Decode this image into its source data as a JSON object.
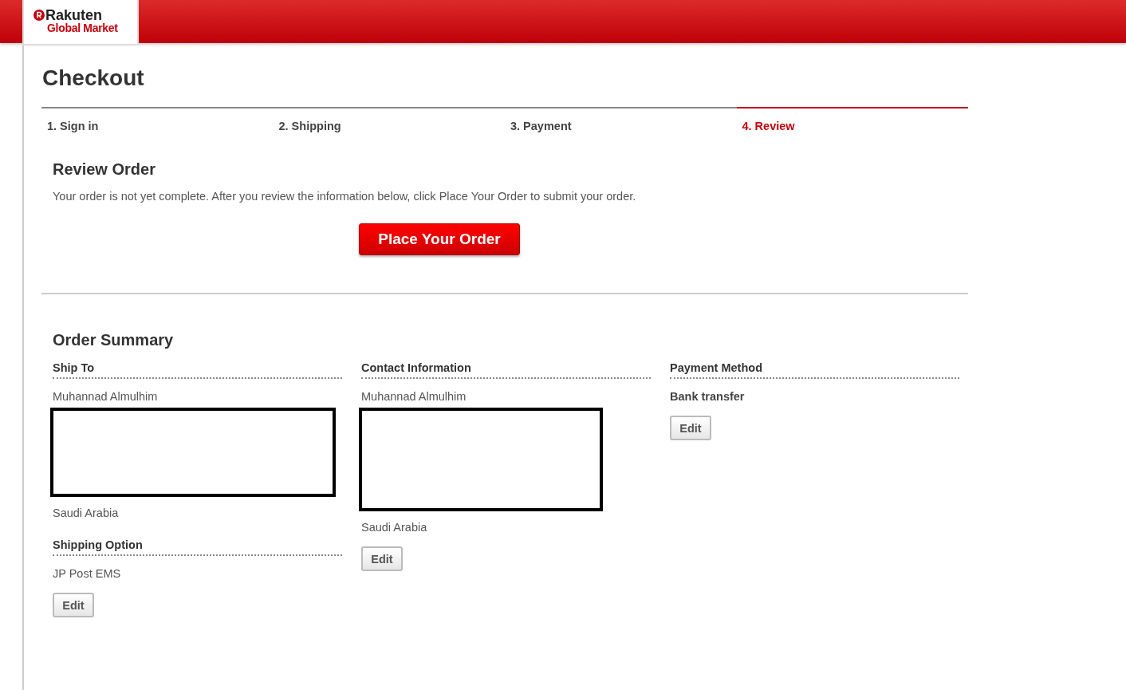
{
  "header": {
    "logo": {
      "line1": "Rakuten",
      "line2": "Global Market"
    }
  },
  "page_title": "Checkout",
  "steps": [
    {
      "label": "1. Sign in",
      "selected": false
    },
    {
      "label": "2. Shipping",
      "selected": false
    },
    {
      "label": "3. Payment",
      "selected": false
    },
    {
      "label": "4. Review",
      "selected": true
    }
  ],
  "review": {
    "heading": "Review Order",
    "message": "Your order is not yet complete. After you review the information below, click Place Your Order to submit your order.",
    "button": "Place Your Order"
  },
  "summary": {
    "heading": "Order Summary",
    "columns": [
      {
        "sections": [
          {
            "heading": "Ship To",
            "lines": [
              {
                "kind": "text",
                "text": "Muhannad Almulhim"
              },
              {
                "kind": "redacted"
              },
              {
                "kind": "text",
                "text": "Saudi Arabia"
              }
            ]
          },
          {
            "heading": "Shipping Option",
            "lines": [
              {
                "kind": "text",
                "text": "JP Post EMS"
              }
            ],
            "button": "Edit"
          }
        ]
      },
      {
        "sections": [
          {
            "heading": "Contact Information",
            "lines": [
              {
                "kind": "text",
                "text": "Muhannad Almulhim"
              },
              {
                "kind": "redacted"
              },
              {
                "kind": "text",
                "text": "Saudi Arabia"
              }
            ],
            "button": "Edit"
          }
        ]
      },
      {
        "sections": [
          {
            "heading": "Payment Method",
            "lines": [
              {
                "kind": "strong",
                "text": "Bank transfer"
              }
            ],
            "button": "Edit"
          }
        ]
      }
    ]
  }
}
